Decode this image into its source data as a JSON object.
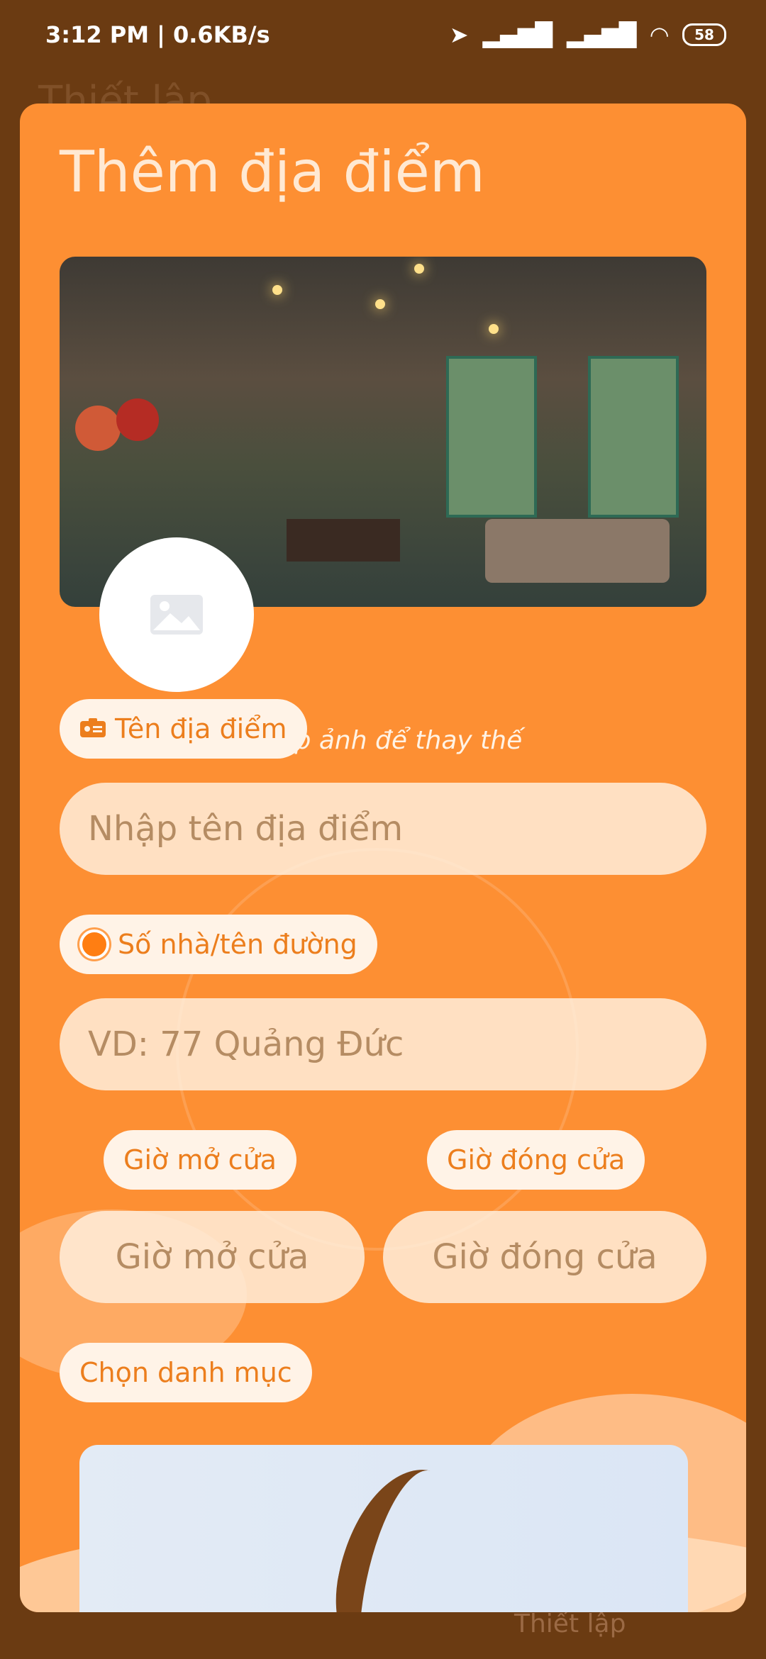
{
  "status_bar": {
    "time": "3:12 PM | 0.6KB/s",
    "battery": "58"
  },
  "background": {
    "title": "Thiết lập",
    "tab": "Thiết lập"
  },
  "modal": {
    "title": "Thêm địa điểm",
    "hint": "Nhấp ảnh để thay thế",
    "name_label": "Tên địa điểm",
    "name_placeholder": "Nhập tên địa điểm",
    "address_label": "Số nhà/tên đường",
    "address_placeholder": "VD: 77 Quảng Đức",
    "open_label": "Giờ mở cửa",
    "close_label": "Giờ đóng cửa",
    "open_placeholder": "Giờ mở cửa",
    "close_placeholder": "Giờ đóng cửa",
    "category_label": "Chọn danh mục"
  },
  "icons": {
    "image_placeholder": "image-icon",
    "name_label_icon": "id-card-icon",
    "address_label_icon": "radio-dot-icon"
  },
  "colors": {
    "accent": "#fd8f33",
    "label_text": "#ec7e1d"
  }
}
